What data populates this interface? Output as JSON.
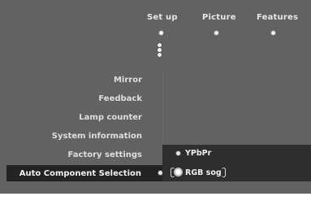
{
  "tabs": [
    {
      "label": "Set up"
    },
    {
      "label": "Picture"
    },
    {
      "label": "Features"
    }
  ],
  "menu": {
    "items": [
      {
        "label": "Mirror"
      },
      {
        "label": "Feedback"
      },
      {
        "label": "Lamp counter"
      },
      {
        "label": "System information"
      },
      {
        "label": "Factory settings"
      }
    ],
    "selected": {
      "label": "Auto Component Selection"
    }
  },
  "submenu": {
    "options": [
      {
        "label": "YPbPr",
        "selected": false
      },
      {
        "label": "RGB sog",
        "selected": true
      }
    ]
  },
  "colors": {
    "background": "#626262",
    "selection_bar": "#232323",
    "submenu_panel": "#2e2e2e"
  }
}
